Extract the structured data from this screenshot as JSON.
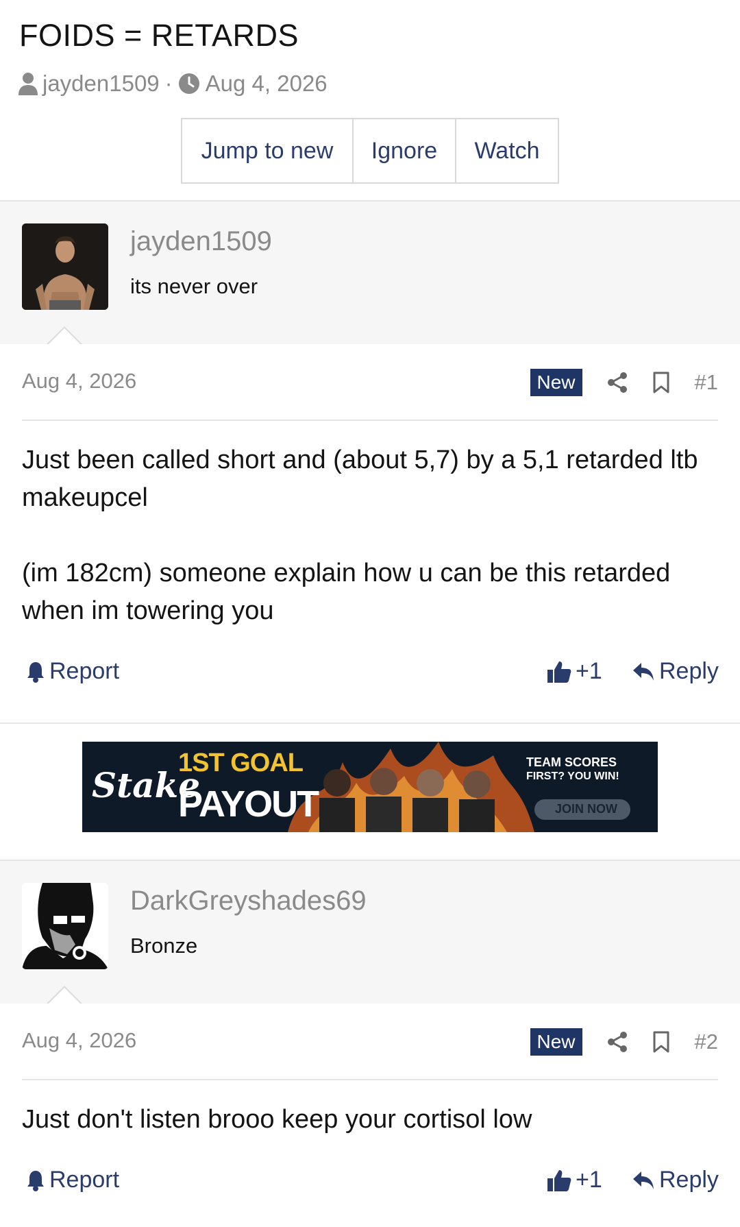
{
  "thread": {
    "title": "FOIDS = RETARDS",
    "author": "jayden1509",
    "separator": "·",
    "date": "Aug 4, 2026",
    "buttons": {
      "jump": "Jump to new",
      "ignore": "Ignore",
      "watch": "Watch"
    }
  },
  "posts": [
    {
      "username": "jayden1509",
      "user_title": "its never over",
      "date": "Aug 4, 2026",
      "badge": "New",
      "number": "#1",
      "paragraphs": [
        "Just been called short and (about 5,7) by a 5,1 retarded ltb makeupcel",
        "(im 182cm) someone explain how u can be this retarded when im towering you"
      ],
      "report_label": "Report",
      "like_label": "+1",
      "reply_label": "Reply"
    },
    {
      "username": "DarkGreyshades69",
      "user_title": "Bronze",
      "date": "Aug 4, 2026",
      "badge": "New",
      "number": "#2",
      "paragraphs": [
        "Just don't listen brooo keep your cortisol low"
      ],
      "report_label": "Report",
      "like_label": "+1",
      "reply_label": "Reply"
    }
  ],
  "ad": {
    "brand": "Stake",
    "headline_1": "1ST GOAL",
    "headline_2": "PAYOUT",
    "tagline_1": "TEAM SCORES",
    "tagline_2": "FIRST? YOU WIN!",
    "cta": "JOIN NOW"
  },
  "colors": {
    "accent": "#1f3566",
    "link": "#2a3c6b",
    "muted": "#8a8a8a"
  }
}
